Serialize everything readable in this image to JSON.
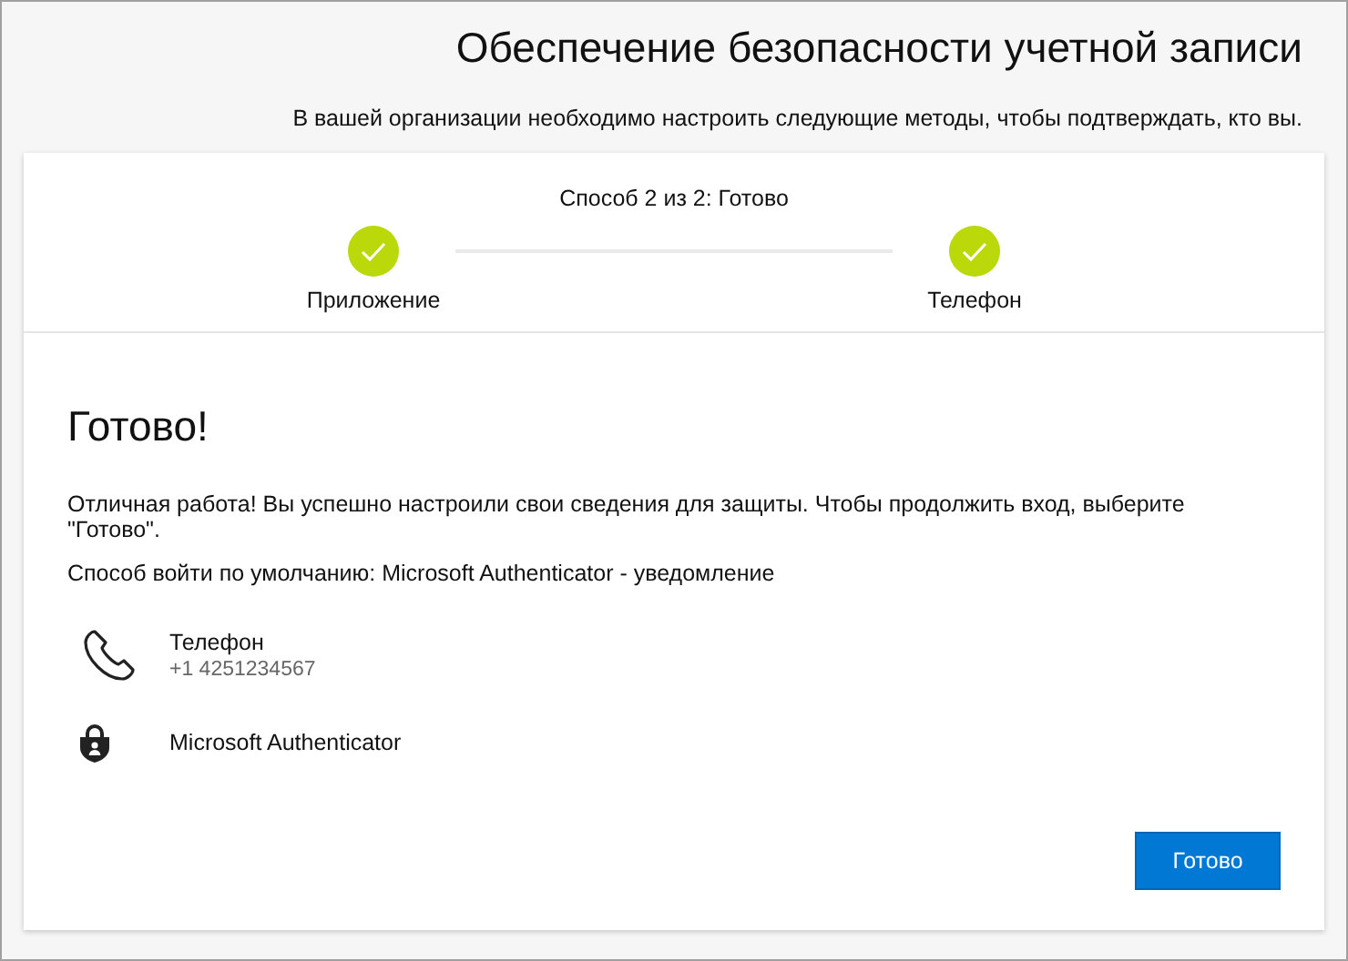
{
  "title": "Обеспечение безопасности учетной записи",
  "subtitle": "В вашей организации необходимо настроить следующие методы, чтобы подтверждать, кто вы.",
  "progress": {
    "caption": "Способ 2 из 2: Готово",
    "steps": [
      {
        "label": "Приложение",
        "done": true
      },
      {
        "label": "Телефон",
        "done": true
      }
    ]
  },
  "heading": "Готово!",
  "message": "Отличная работа! Вы успешно настроили свои сведения для защиты. Чтобы продолжить вход, выберите \"Готово\".",
  "default_method": "Способ войти по умолчанию: Microsoft Authenticator - уведомление",
  "methods": [
    {
      "kind": "phone",
      "name": "Телефон",
      "detail": "+1 4251234567"
    },
    {
      "kind": "authenticator",
      "name": "Microsoft Authenticator"
    }
  ],
  "button": "Готово"
}
